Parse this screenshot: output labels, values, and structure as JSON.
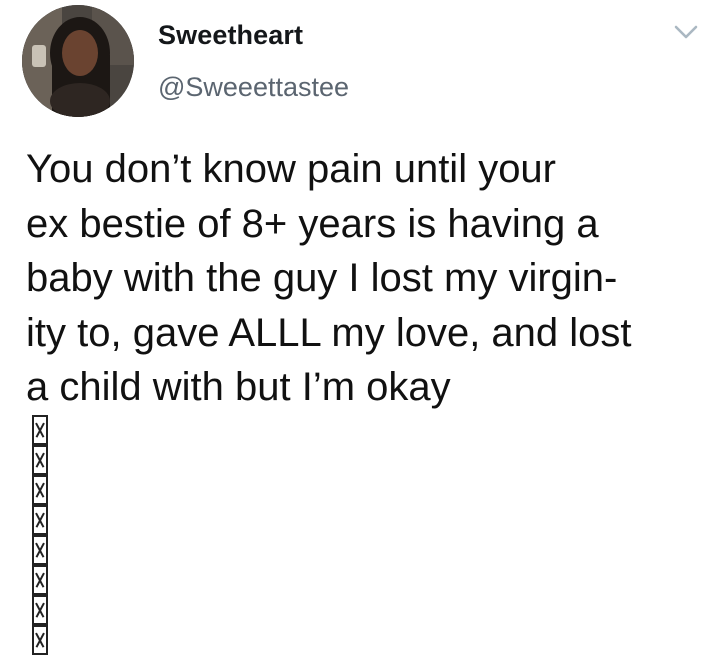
{
  "author": {
    "display_name": "Sweetheart",
    "handle": "@Sweeettastee",
    "avatar_icon": "user-avatar-photo"
  },
  "menu": {
    "icon": "chevron-down-icon"
  },
  "tweet": {
    "lines": [
      "You don’t know pain until your",
      "ex bestie of 8+ years is having a",
      "baby with the guy I lost my virgin-",
      "ity to, gave ALLL my love, and lost",
      "a child with but I’m okay"
    ],
    "emoji_count": 8
  },
  "colors": {
    "name": "#14171a",
    "handle": "#5b6570",
    "chevron": "#aab8c2",
    "text": "#111111"
  }
}
